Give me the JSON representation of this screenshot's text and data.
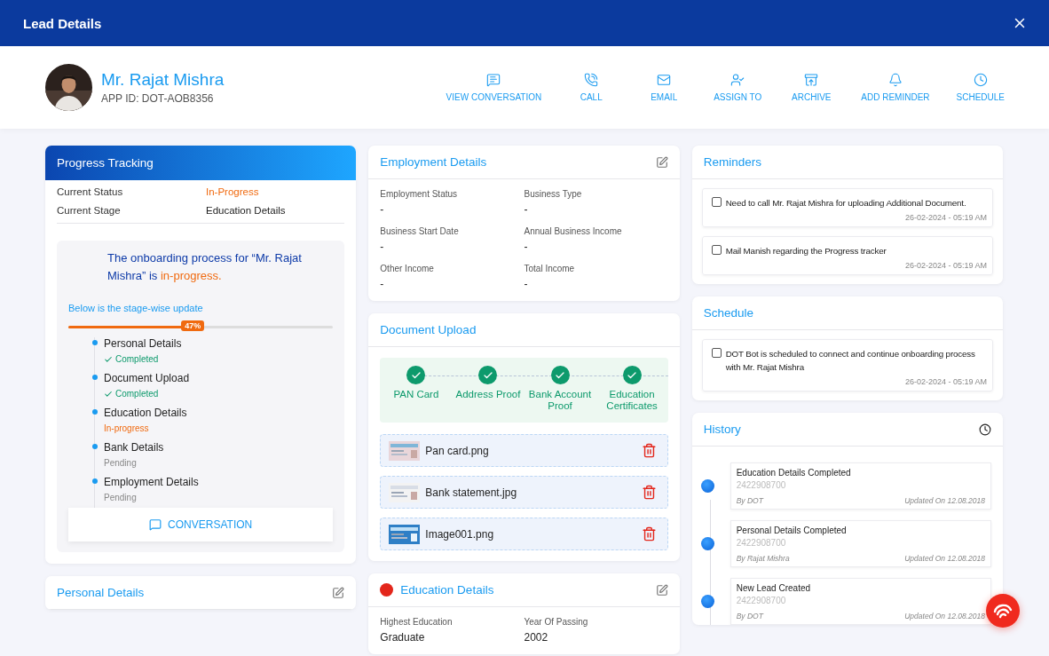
{
  "window": {
    "title": "Lead Details"
  },
  "profile": {
    "name": "Mr. Rajat Mishra",
    "app_id": "APP ID: DOT-AOB8356"
  },
  "actions": [
    {
      "label": "VIEW CONVERSATION",
      "kind": "conversation"
    },
    {
      "label": "CALL",
      "kind": "call"
    },
    {
      "label": "EMAIL",
      "kind": "email"
    },
    {
      "label": "ASSIGN TO",
      "kind": "assign"
    },
    {
      "label": "ARCHIVE",
      "kind": "archive"
    },
    {
      "label": "ADD REMINDER",
      "kind": "reminder"
    },
    {
      "label": "SCHEDULE",
      "kind": "schedule"
    }
  ],
  "progress_tracking": {
    "title": "Progress Tracking",
    "rows": [
      {
        "label": "Current Status",
        "value": "In-Progress",
        "kind": "status"
      },
      {
        "label": "Current Stage",
        "value": "Education Details",
        "kind": "plain"
      }
    ],
    "message": "The onboarding process for “Mr. Rajat Mishra” is *in-progress.*",
    "subtitle": "Below is the stage-wise update",
    "progress": {
      "level": 0.47,
      "label": "47%"
    },
    "stages": [
      {
        "name": "Personal Details",
        "status": "Completed",
        "kind": "completed"
      },
      {
        "name": "Document Upload",
        "status": "Completed",
        "kind": "completed"
      },
      {
        "name": "Education Details",
        "status": "In-progress",
        "kind": "in_progress"
      },
      {
        "name": "Bank Details",
        "status": "Pending",
        "kind": "pending"
      },
      {
        "name": "Employment Details",
        "status": "Pending",
        "kind": "pending"
      }
    ],
    "button": "CONVERSATION"
  },
  "personal_details": {
    "title": "Personal Details"
  },
  "employment_details": {
    "title": "Employment Details",
    "fields": [
      {
        "label": "Employment Status",
        "value": "-"
      },
      {
        "label": "Business Type",
        "value": "-"
      },
      {
        "label": "Business Start Date",
        "value": "-"
      },
      {
        "label": "Annual Business Income",
        "value": "-"
      },
      {
        "label": "Other Income",
        "value": "-"
      },
      {
        "label": "Total Income",
        "value": "-"
      }
    ]
  },
  "document_upload": {
    "title": "Document Upload",
    "steps": [
      {
        "label": "PAN Card",
        "done": true
      },
      {
        "label": "Address Proof",
        "done": true
      },
      {
        "label": "Bank Account Proof",
        "done": true
      },
      {
        "label": "Education Certificates",
        "done": true
      }
    ],
    "files": [
      {
        "name": "Pan card.png"
      },
      {
        "name": "Bank statement.jpg"
      },
      {
        "name": "Image001.png"
      }
    ]
  },
  "education_details": {
    "title": "Education Details",
    "fields": [
      {
        "label": "Highest Education",
        "value": "Graduate"
      },
      {
        "label": "Year Of Passing",
        "value": "2002"
      }
    ]
  },
  "reminders": {
    "title": "Reminders",
    "items": [
      {
        "text": "Need to call Mr. Rajat Mishra for uploading Additional Document.",
        "time": "26-02-2024 - 05:19 AM",
        "checked": false
      },
      {
        "text": "Mail Manish regarding the Progress tracker",
        "time": "26-02-2024 - 05:19 AM",
        "checked": false
      }
    ]
  },
  "schedule": {
    "title": "Schedule",
    "items": [
      {
        "text": "DOT Bot is scheduled to connect and continue onboarding process with Mr. Rajat Mishra",
        "time": "26-02-2024 - 05:19 AM",
        "checked": false
      }
    ]
  },
  "history": {
    "title": "History",
    "items": [
      {
        "title": "Education Details Completed",
        "number": "2422908700",
        "by": "By DOT",
        "updated": "Updated On 12.08.2018"
      },
      {
        "title": "Personal Details Completed",
        "number": "2422908700",
        "by": "By Rajat Mishra",
        "updated": "Updated On 12.08.2018"
      },
      {
        "title": "New Lead Created",
        "number": "2422908700",
        "by": "By DOT",
        "updated": "Updated On 12.08.2018"
      }
    ]
  }
}
